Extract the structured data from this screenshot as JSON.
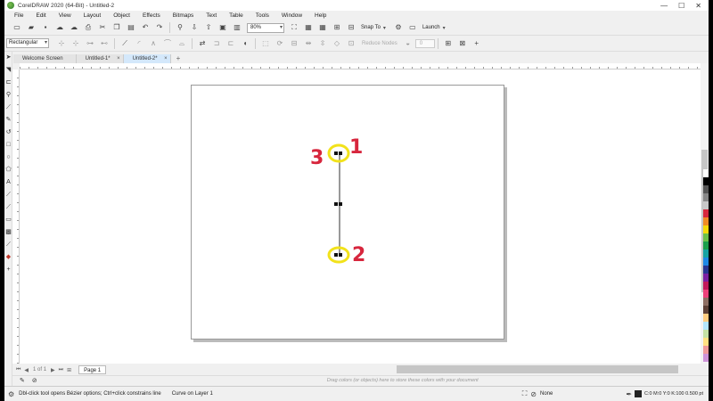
{
  "window": {
    "title": "CorelDRAW 2020 (64-Bit) - Untitled-2",
    "controls": [
      "—",
      "☐",
      "✕"
    ]
  },
  "menu": [
    "File",
    "Edit",
    "View",
    "Layout",
    "Object",
    "Effects",
    "Bitmaps",
    "Text",
    "Table",
    "Tools",
    "Window",
    "Help"
  ],
  "toolbar": {
    "zoom": "80%",
    "snap_to": "Snap To",
    "launch": "Launch"
  },
  "property_bar": {
    "shape_mode": "Rectangular",
    "reduce_nodes": "Reduce Nodes",
    "spin_value": "0"
  },
  "tabs": [
    {
      "label": "Welcome Screen"
    },
    {
      "label": "Untitled-1*"
    },
    {
      "label": "Untitled-2*"
    }
  ],
  "annotations": [
    {
      "label": "1"
    },
    {
      "label": "2"
    },
    {
      "label": "3"
    }
  ],
  "page_nav": {
    "count": "1 of 1",
    "page_tab": "Page 1"
  },
  "hint": "Drag colors (or objects) here to store these colors with your document",
  "status": {
    "hint": "Dbl-click tool opens Bézier options; Ctrl+click constrains line",
    "object": "Curve on Layer 1",
    "fill": "None",
    "outline": "C:0 M:0 Y:0 K:100  0.500 pt"
  },
  "colors": {
    "annotation_red": "#d7263d",
    "highlight_yellow": "#f2e21b",
    "palette": [
      "#ffffff",
      "#000000",
      "#555555",
      "#888888",
      "#c8c8c8",
      "#d7263d",
      "#f08a24",
      "#f5d90a",
      "#6cc04a",
      "#1a9e4a",
      "#16a3a3",
      "#1e88e5",
      "#283593",
      "#7b1fa2",
      "#c2185b",
      "#ec407a",
      "#8d6e63",
      "#5d4037",
      "#ffcc80",
      "#b3e5fc",
      "#c5e1a5",
      "#ffe082",
      "#ef9a9a",
      "#ce93d8"
    ]
  }
}
